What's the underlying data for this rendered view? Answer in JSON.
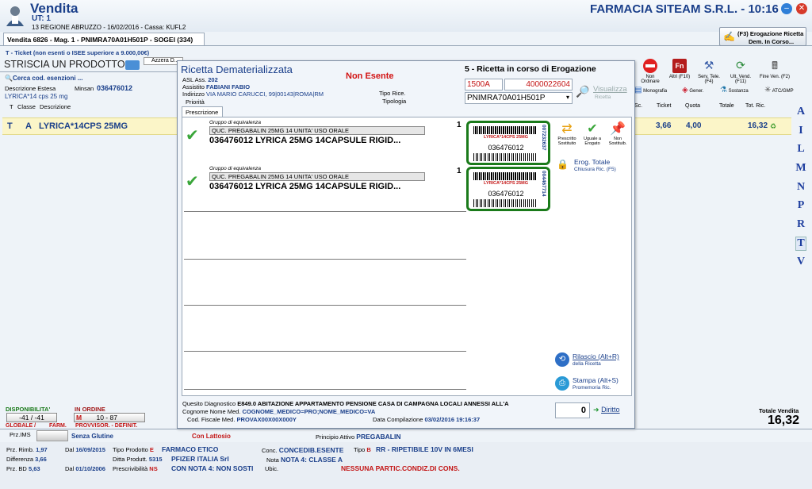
{
  "app": {
    "title": "Vendita",
    "ut": "UT: 1",
    "info": "13 REGIONE ABRUZZO - 16/02/2016 - Cassa: KUFL2",
    "pharmacy": "FARMACIA SITEAM S.R.L. - 10:16"
  },
  "tab": {
    "label": "Vendita 6826 - Mag. 1 - PNIMRA70A01H501P - SOGEI (334)"
  },
  "erog_btn": {
    "label": "(F3) Erogazione Ricetta",
    "sub": "Dem. In Corso..."
  },
  "ticket_note": "T - Ticket (non esenti o ISEE superiore a 9.000,00€)",
  "scan": {
    "label": "STRISCIA UN PRODOTTO",
    "azzera": "Azzera D..."
  },
  "left": {
    "cerca": "Cerca cod. esenzioni ...",
    "desc_estesa": "Descrizione Estesa",
    "minsan_label": "Minsan",
    "minsan": "036476012",
    "desc": "LYRICA*14 cps 25 mg",
    "col_t": "T",
    "col_classe": "Classe",
    "col_desc": "Descrizione"
  },
  "row": {
    "t": "T",
    "classe": "A",
    "desc": "LYRICA*14CPS 25MG",
    "ticket": "3,66",
    "quota": "4,00",
    "tot": "16,32"
  },
  "right_cols": {
    "sc": "Sc.",
    "ticket": "Ticket",
    "quota": "Quota",
    "totale": "Totale",
    "tot_ric": "Tot. Ric."
  },
  "toolbar": [
    {
      "name": "non-ordinare",
      "label": "Non Ordinare"
    },
    {
      "name": "altri",
      "label": "Altri (F10)"
    },
    {
      "name": "serv-tele",
      "label": "Serv. Tele. (F4)"
    },
    {
      "name": "ult-vend",
      "label": "Ult. Vend. (F11)"
    },
    {
      "name": "fine-ven",
      "label": "Fine Ven. (F2)"
    }
  ],
  "toolbar2": [
    {
      "name": "monografia",
      "label": "Monografia"
    },
    {
      "name": "gener",
      "label": "Gener."
    },
    {
      "name": "sostanza",
      "label": "Sostanza"
    },
    {
      "name": "atc-gmp",
      "label": "ATC/GMP"
    }
  ],
  "letters": [
    "A",
    "I",
    "L",
    "M",
    "N",
    "P",
    "R",
    "T",
    "V"
  ],
  "dialog": {
    "title": "Ricetta Dematerializzata",
    "non_esente": "Non Esente",
    "status": "5 - Ricetta in corso di Erogazione",
    "asl_label": "ASL Ass.",
    "asl": "202",
    "assistito_label": "Assistito",
    "assistito": "FABIANI FABIO",
    "indirizzo_label": "Indirizzo",
    "indirizzo": "VIA MARIO CARUCCI, 99|00143|ROMA|RM",
    "priorita": "Priorità",
    "tipo_ricetta": "Tipo Rice.",
    "tipologia": "Tipologia",
    "code1": "1500A",
    "code2": "4000022604",
    "cf": "PNIMRA70A01H501P",
    "visualizza": "Visualizza",
    "visualizza_sub": "Ricetta",
    "tab_prescrizione": "Prescrizione",
    "items": [
      {
        "gruppo_label": "Gruppo di equivalenza",
        "gruppo": "QUC. PREGABALIN 25MG 14 UNITA' USO ORALE",
        "qty": "1",
        "product": "036476012  LYRICA 25MG 14CAPSULE RIGID...",
        "barcode_name": "LYRICA*14CPS 25MG",
        "barcode_code": "036476012",
        "side_code": "007232637"
      },
      {
        "gruppo_label": "Gruppo di equivalenza",
        "gruppo": "QUC. PREGABALIN 25MG 14 UNITA' USO ORALE",
        "qty": "1",
        "product": "036476012  LYRICA 25MG 14CAPSULE RIGID...",
        "barcode_name": "LYRICA*14CPS 25MG",
        "barcode_code": "036476012",
        "side_code": "004467714"
      }
    ],
    "actions": {
      "prescritto": "Prescritto",
      "sostituito": "Sostituito",
      "uguale": "Uguale a",
      "erogato": "Erogato",
      "non": "Non",
      "sostituib": "Sostituib."
    },
    "erog_totale": "Erog. Totale",
    "chiusura": "Chiusura Ric. (F5)",
    "rilascio": "Rilascio (Alt+R)",
    "rilascio_sub": "della Ricetta",
    "stampa": "Stampa (Alt+S)",
    "stampa_sub": "Promemoria Ric.",
    "quesito_label": "Quesito Diagnostico",
    "quesito": "E849.0 ABITAZIONE APPARTAMENTO PENSIONE CASA DI CAMPAGNA LOCALI ANNESSI ALL'A",
    "cognome_label": "Cognome Nome Med.",
    "cognome": "COGNOME_MEDICO=PRO;NOME_MEDICO=VA",
    "cf_med_label": "Cod. Fiscale Med.",
    "cf_med": "PROVAX00X00X000Y",
    "data_label": "Data Compilazione",
    "data": "03/02/2016 19:16:37",
    "diritto_val": "0",
    "diritto": "Diritto"
  },
  "bottom": {
    "disponibilita": "DISPONIBILITA'",
    "in_ordine": "IN ORDINE",
    "disp_val": "-41 / -41",
    "ord_val": "10 - 87",
    "ord_m": "M",
    "globale": "GLOBALE /",
    "farm": "FARM.",
    "provvisor": "PROVVISOR. - DEFINIT.",
    "totale_label": "Totale Vendita",
    "totale": "16,32",
    "prz_ims": "Prz.IMS",
    "senza_glutine": "Senza Glutine",
    "con_lattosio": "Con Lattosio",
    "principio_label": "Principio Attivo",
    "principio": "PREGABALIN",
    "prz_rimb_label": "Prz. Rimb.",
    "prz_rimb": "1,97",
    "dal1_label": "Dal",
    "dal1": "16/09/2015",
    "tipo_prod_label": "Tipo Prodotto",
    "tipo_prod": "E",
    "farmaco": "FARMACO ETICO",
    "conc_label": "Conc.",
    "conc": "CONCEDIB.ESENTE",
    "tipo_label": "Tipo",
    "tipo": "B",
    "rr": "RR - RIPETIBILE 10V IN 6MESI",
    "diff_label": "Differenza",
    "diff": "3,66",
    "ditta_label": "Ditta Produtt.",
    "ditta_code": "5315",
    "ditta": "PFIZER ITALIA Srl",
    "nota_label": "Nota",
    "nota": "NOTA 4: CLASSE A",
    "prz_bd_label": "Prz. BD",
    "prz_bd": "5,63",
    "dal2_label": "Dal",
    "dal2": "01/10/2006",
    "prescr_label": "Prescrivibilità",
    "prescr": "NS",
    "con_nota": "CON NOTA 4: NON SOSTI",
    "ubic_label": "Ubic.",
    "nessuna": "NESSUNA PARTIC.CONDIZ.DI CONS."
  }
}
